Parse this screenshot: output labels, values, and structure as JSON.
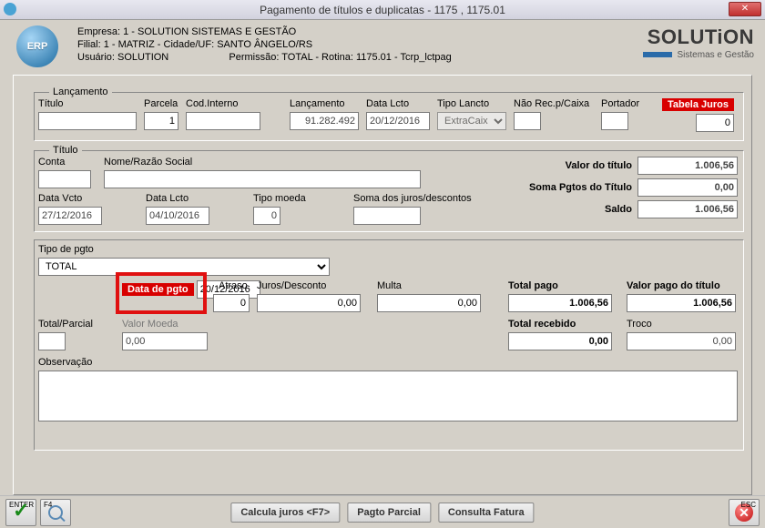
{
  "window": {
    "title": "Pagamento de títulos e duplicatas - 1175 , 1175.01"
  },
  "header": {
    "empresa": "Empresa: 1 - SOLUTION SISTEMAS E GESTÃO",
    "filial": "Filial: 1 - MATRIZ - Cidade/UF: SANTO ÂNGELO/RS",
    "usuario": "Usuário: SOLUTION",
    "permissao": "Permissão: TOTAL - Rotina: 1175.01 - Tcrp_lctpag"
  },
  "brand": {
    "name": "SOLUTiON",
    "tagline": "Sistemas e Gestão"
  },
  "lancamento": {
    "legend": "Lançamento",
    "labels": {
      "titulo": "Título",
      "parcela": "Parcela",
      "cod_interno": "Cod.Interno",
      "lancamento": "Lançamento",
      "data_lcto": "Data Lcto",
      "tipo_lancto": "Tipo Lancto",
      "nao_rec": "Não Rec.p/Caixa",
      "portador": "Portador",
      "tabela_juros": "Tabela Juros"
    },
    "values": {
      "titulo": "",
      "parcela": "1",
      "cod_interno": "",
      "lancamento": "91.282.492",
      "data_lcto": "20/12/2016",
      "tipo_lancto": "ExtraCaixa",
      "nao_rec": "",
      "portador": "",
      "tabela_juros": "0"
    }
  },
  "titulo": {
    "legend": "Título",
    "labels": {
      "conta": "Conta",
      "nome": "Nome/Razão Social",
      "valor_titulo": "Valor do título",
      "soma_pgtos": "Soma Pgtos do Título",
      "saldo": "Saldo",
      "data_vcto": "Data Vcto",
      "data_lcto": "Data Lcto",
      "tipo_moeda": "Tipo moeda",
      "soma_juros": "Soma dos juros/descontos"
    },
    "values": {
      "conta": "",
      "nome": "",
      "valor_titulo": "1.006,56",
      "soma_pgtos": "0,00",
      "saldo": "1.006,56",
      "data_vcto": "27/12/2016",
      "data_lcto": "04/10/2016",
      "tipo_moeda": "0",
      "soma_juros": ""
    }
  },
  "pgto_panel": {
    "labels": {
      "tipo_pgto": "Tipo de pgto",
      "data_pgto": "Data de pgto",
      "atraso": "Atraso",
      "juros_desc": "Juros/Desconto",
      "multa": "Multa",
      "total_pago": "Total pago",
      "valor_pago": "Valor pago do título",
      "total_parcial": "Total/Parcial",
      "valor_moeda": "Valor Moeda",
      "total_recebido": "Total recebido",
      "troco": "Troco",
      "observacao": "Observação"
    },
    "values": {
      "tipo_pgto": "TOTAL",
      "data_pgto": "20/12/2016",
      "atraso": "0",
      "juros_desc": "0,00",
      "multa": "0,00",
      "total_pago": "1.006,56",
      "valor_pago": "1.006,56",
      "total_parcial": "",
      "valor_moeda": "0,00",
      "total_recebido": "0,00",
      "troco": "0,00",
      "observacao": ""
    }
  },
  "buttons": {
    "enter": "ENTER",
    "f4": "F4",
    "calc_juros": "Calcula juros <F7>",
    "pagto_parcial": "Pagto Parcial",
    "consulta_fatura": "Consulta Fatura",
    "esc": "ESC"
  }
}
